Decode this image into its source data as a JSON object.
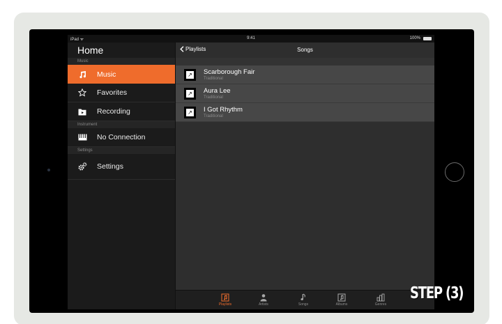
{
  "statusbar": {
    "carrier": "iPad ᯤ",
    "time": "9:41",
    "battery": "100%"
  },
  "sidebar": {
    "title": "Home",
    "sections": [
      {
        "header": "Music",
        "items": [
          {
            "label": "Music",
            "icon": "music-note-icon",
            "active": true
          },
          {
            "label": "Favorites",
            "icon": "star-icon"
          },
          {
            "label": "Recording",
            "icon": "folder-record-icon"
          }
        ]
      },
      {
        "header": "Instrument",
        "items": [
          {
            "label": "No Connection",
            "icon": "keyboard-icon"
          }
        ]
      },
      {
        "header": "Settings",
        "items": [
          {
            "label": "Settings",
            "icon": "gears-icon"
          }
        ]
      }
    ]
  },
  "content": {
    "back_label": "Playlists",
    "title": "Songs",
    "songs": [
      {
        "title": "Scarborough Fair",
        "subtitle": "Traditional"
      },
      {
        "title": "Aura Lee",
        "subtitle": "Traditional"
      },
      {
        "title": "I Got Rhythm",
        "subtitle": "Traditional"
      }
    ]
  },
  "tabbar": {
    "tabs": [
      {
        "label": "Playlists",
        "icon": "playlists-icon",
        "active": true
      },
      {
        "label": "Artists",
        "icon": "artists-icon"
      },
      {
        "label": "Songs",
        "icon": "songs-icon"
      },
      {
        "label": "Albums",
        "icon": "albums-icon"
      },
      {
        "label": "Genres",
        "icon": "genres-icon"
      }
    ]
  },
  "overlay": {
    "step_label": "STEP (3)"
  },
  "colors": {
    "accent": "#ef6c2c",
    "sidebar_bg": "#1b1b1b",
    "row_bg": "#474747"
  }
}
